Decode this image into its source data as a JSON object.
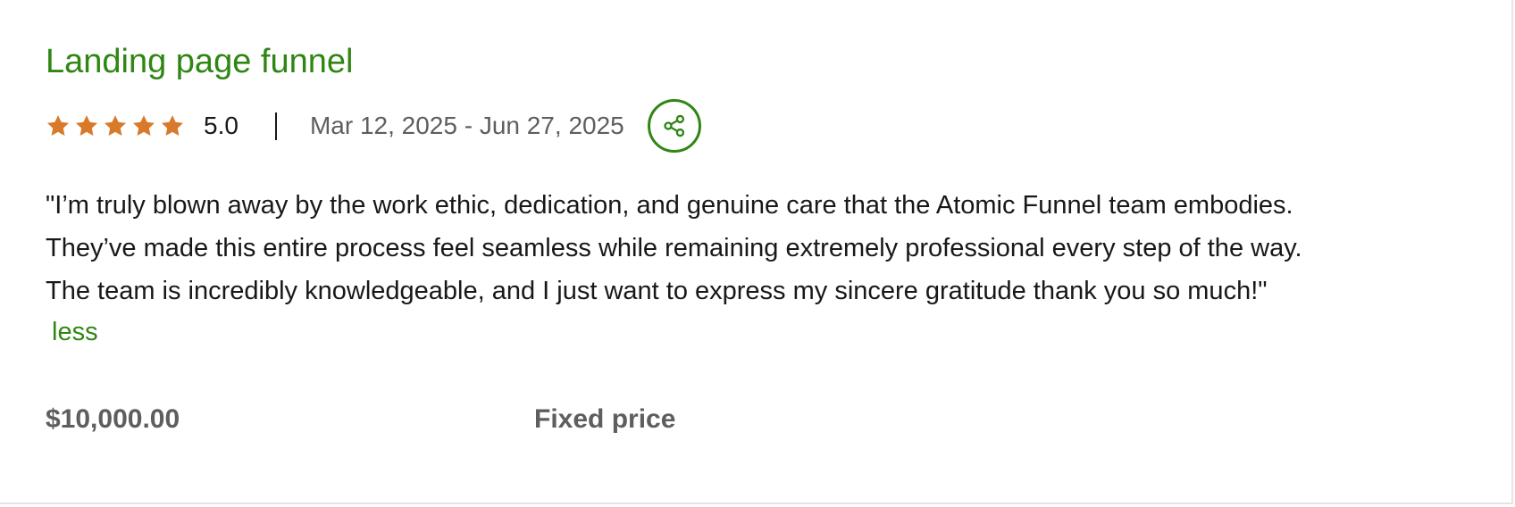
{
  "card": {
    "title": "Landing page funnel",
    "rating": {
      "stars": 5,
      "max_stars": 5,
      "value_label": "5.0",
      "star_color": "#d97a2b"
    },
    "date_range": "Mar 12, 2025 - Jun 27, 2025",
    "share_icon": "share-icon",
    "review_lines": [
      "\"I’m truly blown away by the work ethic, dedication, and genuine care that the Atomic Funnel team embodies.",
      "They’ve made this entire process feel seamless while remaining extremely professional every step of the way.",
      "The team is incredibly knowledgeable, and I just want to express my sincere gratitude thank you so much!\""
    ],
    "less_label": "less",
    "price": "$10,000.00",
    "price_type": "Fixed price"
  },
  "colors": {
    "accent": "#2f8613",
    "star": "#d97a2b",
    "muted_text": "#5e5e5e",
    "body_text": "#181818"
  }
}
